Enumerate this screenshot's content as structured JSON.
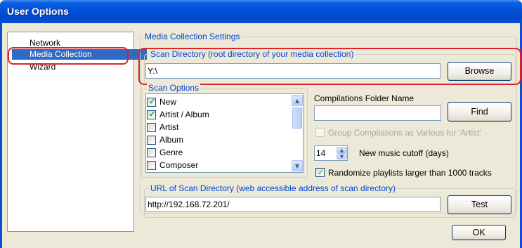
{
  "window": {
    "title": "User Options"
  },
  "nav": {
    "items": [
      "Network",
      "Media Collection",
      "Wizard"
    ],
    "selected": "Media Collection"
  },
  "media_collection": {
    "group_label": "Media Collection Settings",
    "scan_directory": {
      "label": "Scan Directory  (root directory of your media collection)",
      "value": "Y:\\",
      "browse_label": "Browse"
    },
    "scan_options": {
      "label": "Scan Options",
      "items": [
        {
          "label": "New",
          "checked": true
        },
        {
          "label": "Artist / Album",
          "checked": true
        },
        {
          "label": "Artist",
          "checked": false
        },
        {
          "label": "Album",
          "checked": false
        },
        {
          "label": "Genre",
          "checked": false
        },
        {
          "label": "Composer",
          "checked": false
        }
      ]
    },
    "compilations": {
      "label": "Compilations Folder Name",
      "value": "",
      "find_label": "Find",
      "group_checkbox_label": "Group Compilations as Various for 'Artist'",
      "group_checked": false
    },
    "cutoff": {
      "value": "14",
      "label": "New music cutoff (days)"
    },
    "randomize": {
      "label": "Randomize playlists larger than 1000 tracks",
      "checked": true
    },
    "url": {
      "label": "URL of Scan Directory  (web accessible address of scan directory)",
      "value": "http://192.168.72.201/",
      "test_label": "Test"
    }
  },
  "footer": {
    "ok_label": "OK"
  },
  "colors": {
    "titlebar": "#0054e3",
    "selection": "#316ac5",
    "highlight": "#e0202a",
    "group_label": "#0046d5",
    "dialog_bg": "#ece9d8"
  },
  "icons": {
    "checkmark": "check-icon",
    "scroll_up": "arrow-up-icon",
    "scroll_down": "arrow-down-icon"
  }
}
